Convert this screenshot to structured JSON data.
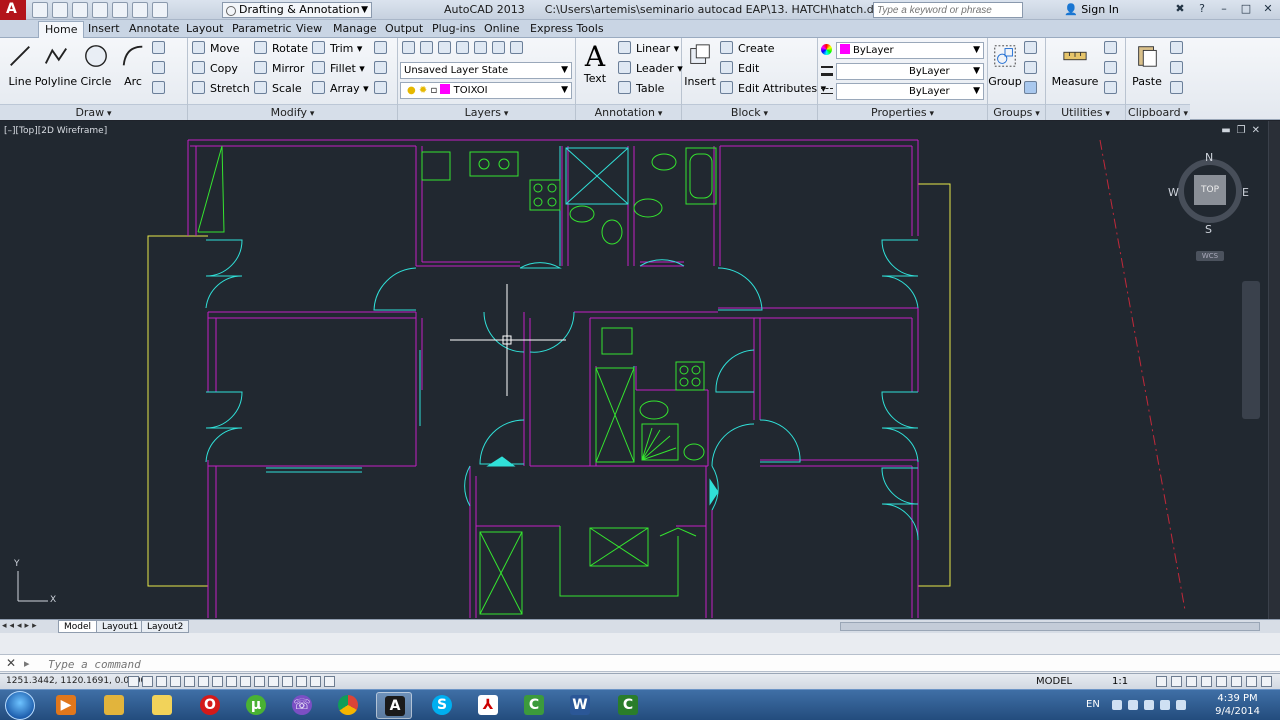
{
  "titlebar": {
    "workspace": "Drafting & Annotation",
    "app_name": "AutoCAD 2013",
    "file_path": "C:\\Users\\artemis\\seminario autocad EAP\\13. HATCH\\hatch.dwg",
    "search_placeholder": "Type a keyword or phrase",
    "sign_in": "Sign In"
  },
  "menu_tabs": [
    "Home",
    "Insert",
    "Annotate",
    "Layout",
    "Parametric",
    "View",
    "Manage",
    "Output",
    "Plug-ins",
    "Online",
    "Express Tools"
  ],
  "ribbon": {
    "draw": {
      "title": "Draw",
      "line": "Line",
      "polyline": "Polyline",
      "circle": "Circle",
      "arc": "Arc"
    },
    "modify": {
      "title": "Modify",
      "move": "Move",
      "rotate": "Rotate",
      "trim": "Trim",
      "copy": "Copy",
      "mirror": "Mirror",
      "fillet": "Fillet",
      "stretch": "Stretch",
      "scale": "Scale",
      "array": "Array"
    },
    "layers": {
      "title": "Layers",
      "layer_state": "Unsaved Layer State",
      "current_layer": "TOIXOI",
      "layer_color": "#ff00ff"
    },
    "annotation": {
      "title": "Annotation",
      "text": "Text",
      "linear": "Linear",
      "leader": "Leader",
      "table": "Table"
    },
    "block": {
      "title": "Block",
      "insert": "Insert",
      "create": "Create",
      "edit": "Edit",
      "edit_attributes": "Edit Attributes"
    },
    "properties": {
      "title": "Properties",
      "color": "ByLayer",
      "linetype": "ByLayer",
      "lineweight": "ByLayer",
      "color_swatch": "#ff00ff"
    },
    "groups": {
      "title": "Groups",
      "group": "Group"
    },
    "utilities": {
      "title": "Utilities",
      "measure": "Measure"
    },
    "clipboard": {
      "title": "Clipboard",
      "paste": "Paste"
    }
  },
  "viewport": {
    "label": "[–][Top][2D Wireframe]",
    "viewcube": {
      "n": "N",
      "s": "S",
      "e": "E",
      "w": "W",
      "top": "TOP",
      "wcs": "WCS"
    },
    "ucs_x": "X",
    "ucs_y": "Y"
  },
  "layout_tabs": [
    "Model",
    "Layout1",
    "Layout2"
  ],
  "command": {
    "placeholder": "Type a command",
    "close": "✕"
  },
  "status": {
    "coords": "1251.3442, 1120.1691, 0.0000",
    "model": "MODEL",
    "scale": "1:1"
  },
  "taskbar": {
    "lang": "EN",
    "time": "4:39 PM",
    "date": "9/4/2014"
  },
  "colors": {
    "wall": "#c21fc5",
    "fixture": "#35e52f",
    "door": "#30e0d8",
    "boundary": "#e8e84a",
    "crosshair": "#ffffff",
    "background": "#212830"
  }
}
